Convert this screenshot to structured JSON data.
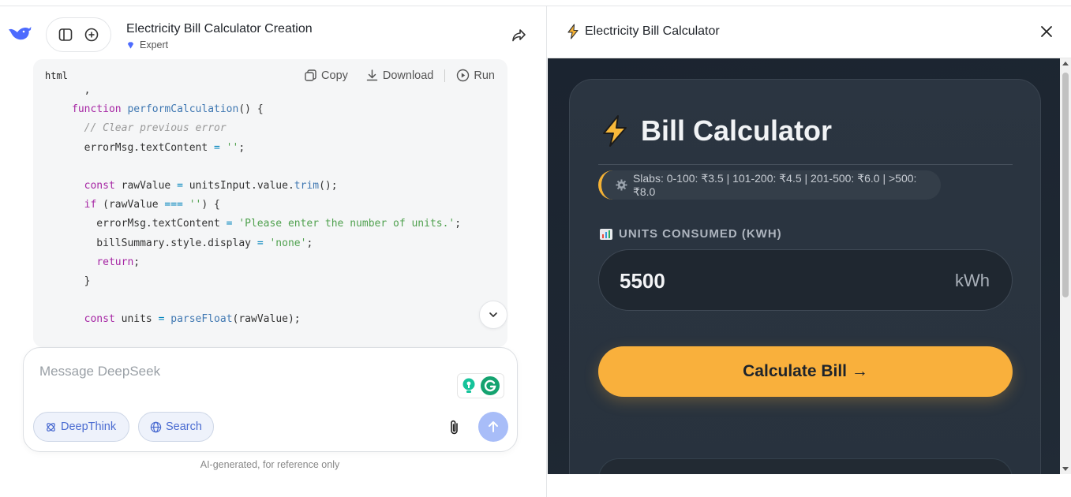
{
  "chat": {
    "title": "Electricity Bill Calculator Creation",
    "mode": "Expert",
    "code_card": {
      "language": "html",
      "copy_label": "Copy",
      "download_label": "Download",
      "run_label": "Run"
    },
    "composer": {
      "placeholder": "Message DeepSeek",
      "deepthink_label": "DeepThink",
      "search_label": "Search"
    },
    "disclaimer": "AI-generated, for reference only"
  },
  "preview": {
    "title": "Electricity Bill Calculator",
    "app": {
      "heading": "Bill Calculator",
      "slabs": "Slabs: 0-100: ₹3.5 | 101-200: ₹4.5 | 201-500: ₹6.0 | >500: ₹8.0",
      "units_label": "UNITS CONSUMED (KWH)",
      "units_value": "5500",
      "units_unit": "kWh",
      "calculate_label": "Calculate Bill →"
    }
  },
  "colors": {
    "accent": "#f9b03c",
    "chip_text": "#4a6bd1",
    "send_button": "#a8bdf8",
    "app_bg": "#1e2732"
  },
  "icons": [
    "deepseek-logo-icon",
    "sidebar-toggle-icon",
    "new-chat-icon",
    "share-icon",
    "copy-icon",
    "download-icon",
    "run-icon",
    "chevron-down-icon",
    "grammarly-icon",
    "deepthink-icon",
    "globe-icon",
    "attach-icon",
    "send-arrow-icon",
    "bolt-icon",
    "close-icon",
    "gear-icon",
    "chart-icon"
  ]
}
